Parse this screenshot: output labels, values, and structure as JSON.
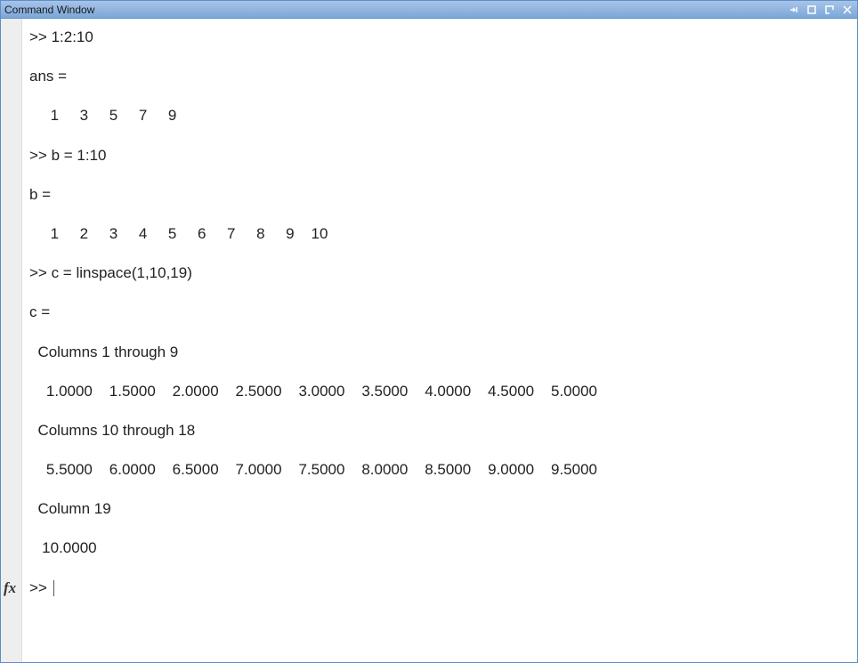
{
  "window": {
    "title": "Command Window"
  },
  "console": {
    "lines": [
      ">> 1:2:10",
      "",
      "ans =",
      "",
      "     1     3     5     7     9",
      "",
      ">> b = 1:10",
      "",
      "b =",
      "",
      "     1     2     3     4     5     6     7     8     9    10",
      "",
      ">> c = linspace(1,10,19)",
      "",
      "c =",
      "",
      "  Columns 1 through 9",
      "",
      "    1.0000    1.5000    2.0000    2.5000    3.0000    3.5000    4.0000    4.5000    5.0000",
      "",
      "  Columns 10 through 18",
      "",
      "    5.5000    6.0000    6.5000    7.0000    7.5000    8.0000    8.5000    9.0000    9.5000",
      "",
      "  Column 19",
      "",
      "   10.0000",
      ""
    ],
    "prompt": ">> ",
    "fx_label": "fx"
  }
}
